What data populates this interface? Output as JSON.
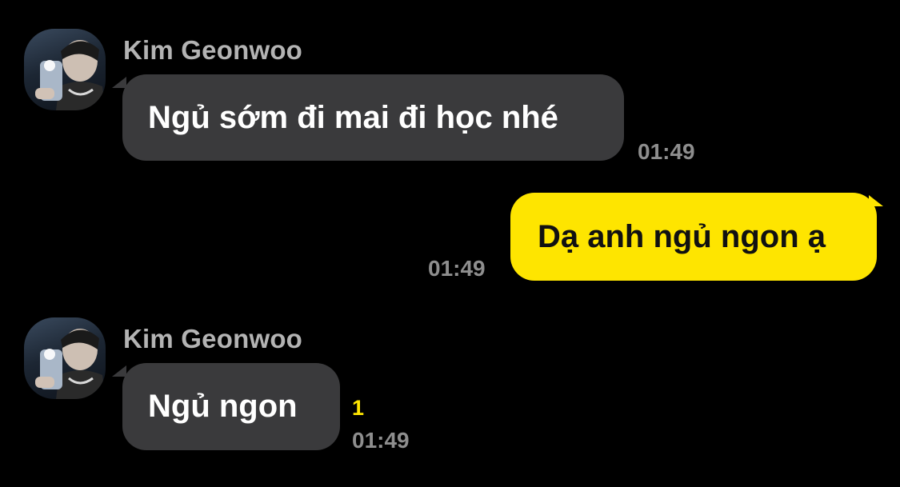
{
  "theme": {
    "background": "#000000",
    "incoming_bubble": "#3a3a3c",
    "outgoing_bubble": "#fee500",
    "sender_color": "#b3b3b3",
    "time_color": "#8e8e8e",
    "unread_color": "#fee500"
  },
  "messages": [
    {
      "direction": "incoming",
      "sender": "Kim Geonwoo",
      "avatar": "profile-photo",
      "text": "Ngủ sớm đi mai đi học nhé",
      "time": "01:49"
    },
    {
      "direction": "outgoing",
      "text": "Dạ anh ngủ ngon ạ",
      "time": "01:49"
    },
    {
      "direction": "incoming",
      "sender": "Kim Geonwoo",
      "avatar": "profile-photo",
      "text": "Ngủ ngon",
      "time": "01:49",
      "unread_count": "1"
    }
  ]
}
